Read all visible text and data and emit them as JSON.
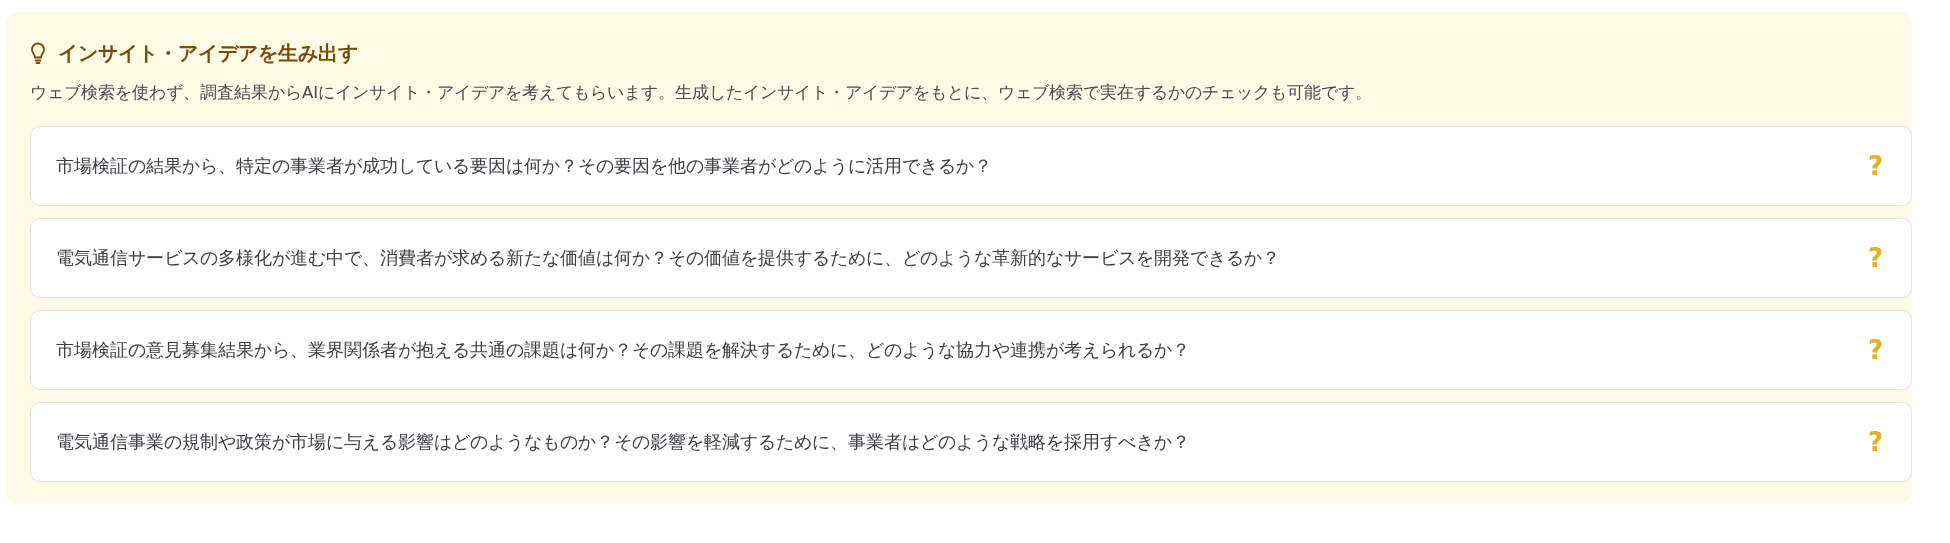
{
  "panel": {
    "title": "インサイト・アイデアを生み出す",
    "description": "ウェブ検索を使わず、調査結果からAIにインサイト・アイデアを考えてもらいます。生成したインサイト・アイデアをもとに、ウェブ検索で実在するかのチェックも可能です。",
    "items": [
      {
        "text": "市場検証の結果から、特定の事業者が成功している要因は何か？その要因を他の事業者がどのように活用できるか？",
        "mark": "?"
      },
      {
        "text": "電気通信サービスの多様化が進む中で、消費者が求める新たな価値は何か？その価値を提供するために、どのような革新的なサービスを開発できるか？",
        "mark": "?"
      },
      {
        "text": "市場検証の意見募集結果から、業界関係者が抱える共通の課題は何か？その課題を解決するために、どのような協力や連携が考えられるか？",
        "mark": "?"
      },
      {
        "text": "電気通信事業の規制や政策が市場に与える影響はどのようなものか？その影響を軽減するために、事業者はどのような戦略を採用すべきか？",
        "mark": "?"
      }
    ]
  }
}
